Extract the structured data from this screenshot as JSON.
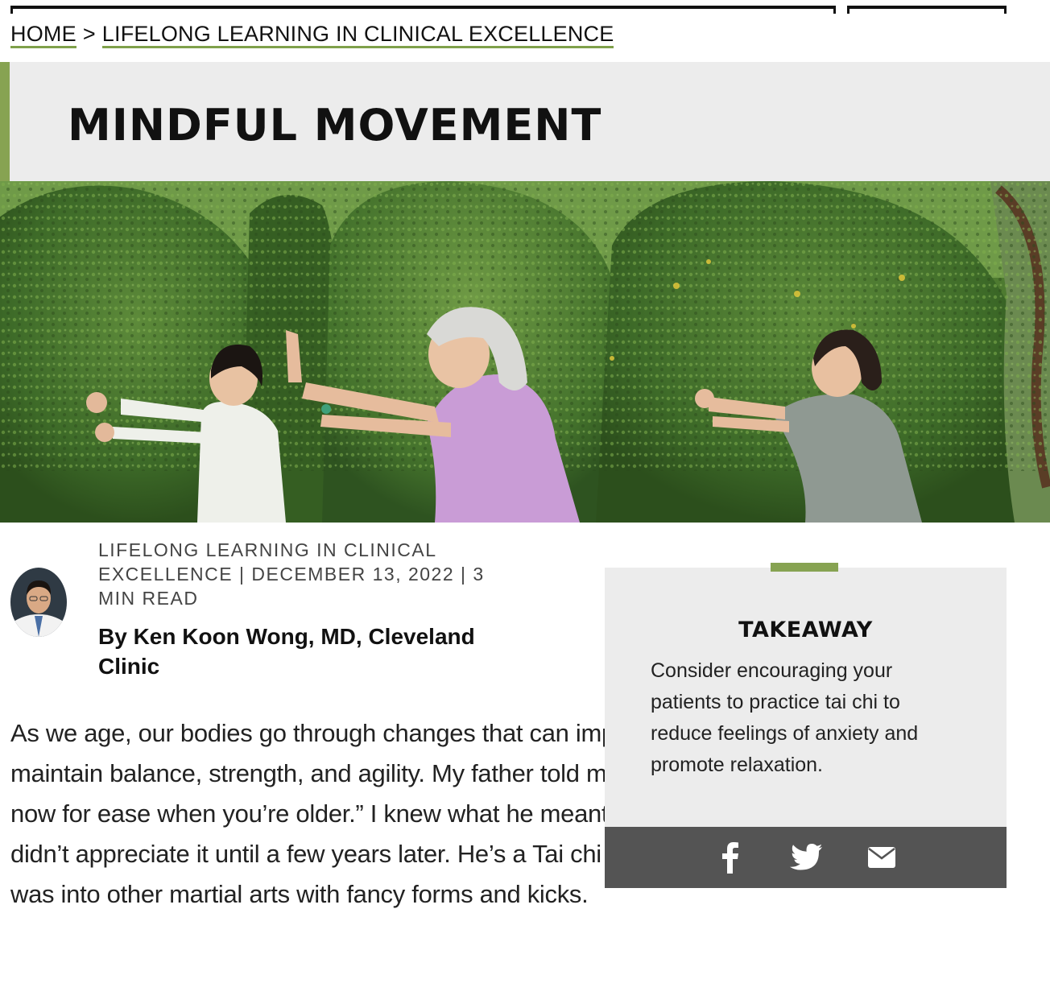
{
  "breadcrumb": {
    "home": "HOME",
    "separator": ">",
    "current": "LIFELONG LEARNING IN CLINICAL EXCELLENCE"
  },
  "article": {
    "title": "MINDFUL MOVEMENT",
    "meta": "LIFELONG LEARNING IN CLINICAL EXCELLENCE | DECEMBER 13, 2022 | 3 MIN READ",
    "byline": "By Ken Koon Wong, MD, Cleveland Clinic",
    "body": "As we age, our bodies go through changes that can impact our ability to maintain balance, strength, and agility. My father told me, “Invest in yourself now for ease when you’re older.” I knew what he meant at the time but didn’t appreciate it until a few years later. He’s a Tai chi practitioner, and I was into other martial arts with fancy forms and kicks."
  },
  "takeaway": {
    "heading": "TAKEAWAY",
    "text": "Consider encouraging your patients to practice tai chi to reduce feelings of anxiety and promote relaxation."
  },
  "share": {
    "icons": [
      "facebook-icon",
      "twitter-icon",
      "email-icon"
    ]
  },
  "colors": {
    "accent_green": "#87a352",
    "band_gray": "#ececec",
    "share_bar": "#545454"
  }
}
